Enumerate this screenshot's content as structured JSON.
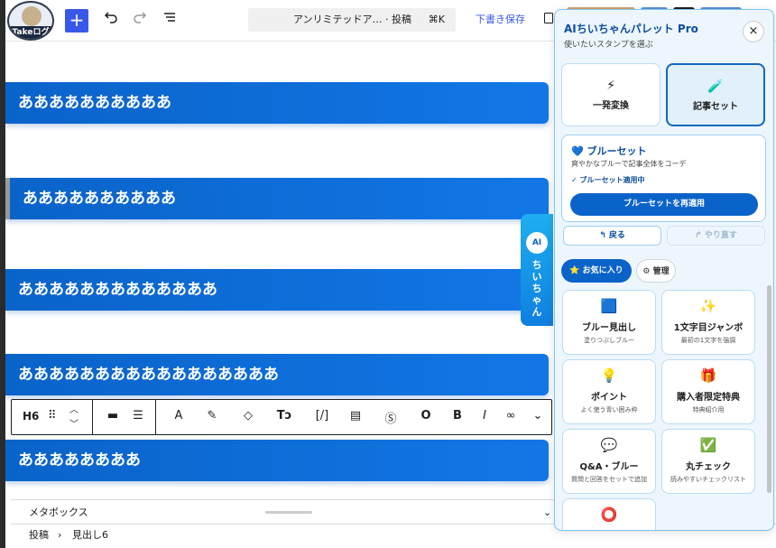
{
  "logo": {
    "text": "Takeログ"
  },
  "toolbar": {
    "add_label": "+",
    "undo_icon": "undo-icon",
    "redo_icon": "redo-icon",
    "list_icon": "list-view-icon",
    "doc_title": "アンリミテッドア… · 投稿",
    "shortcut": "⌘K",
    "save_draft": "下書き保存"
  },
  "blocks": [
    {
      "text": "ああああああああああ"
    },
    {
      "text": "ああああああああああ"
    },
    {
      "text": "あああああああああああああ"
    },
    {
      "text": "あああああああああああああああああ"
    },
    {
      "text": "ああああああああ"
    }
  ],
  "block_toolbar": {
    "heading_level": "H6",
    "items": [
      "align-icon",
      "justify-icon",
      "text-A-icon",
      "highlighter-icon",
      "tag-icon",
      "text-size-icon",
      "shortcode-icon",
      "document-icon",
      "dollar-icon",
      "circle-icon",
      "bold-icon",
      "italic-icon",
      "link-icon",
      "more-chevron-icon"
    ]
  },
  "metabox": {
    "label": "メタボックス"
  },
  "breadcrumb": {
    "root": "投稿",
    "sep": "›",
    "current": "見出し6"
  },
  "ai_tab": {
    "badge": "AI",
    "label": "ちいちゃん"
  },
  "panel": {
    "title": "AIちいちゃんパレット Pro",
    "subtitle": "使いたいスタンプを選ぶ",
    "close": "×",
    "modes": [
      {
        "label": "一発変換",
        "icon": "⚡"
      },
      {
        "label": "記事セット",
        "icon": "🧪"
      }
    ],
    "preset": {
      "heading": "💙 ブルーセット",
      "desc": "爽やかなブルーで記事全体をコーデ",
      "status": "✓ ブルーセット適用中",
      "button": "ブルーセットを再適用"
    },
    "undo": "↰ 戻る",
    "redo": "↱ やり直す",
    "tabs": [
      {
        "label": "⭐ お気に入り"
      },
      {
        "label": "⚙ 管理"
      }
    ],
    "cards": [
      {
        "icon": "🟦",
        "title": "ブルー見出し",
        "desc": "塗りつぶしブルー"
      },
      {
        "icon": "✨",
        "title": "1文字目ジャンボ",
        "desc": "最初の1文字を強調"
      },
      {
        "icon": "💡",
        "title": "ポイント",
        "desc": "よく使う青い囲み枠"
      },
      {
        "icon": "🎁",
        "title": "購入者限定特典",
        "desc": "特典紹介用"
      },
      {
        "icon": "💬",
        "title": "Q&A・ブルー",
        "desc": "質問と回答をセットで追加"
      },
      {
        "icon": "✅",
        "title": "丸チェック",
        "desc": "読みやすいチェックリスト"
      },
      {
        "icon": "⭕",
        "title": "",
        "desc": ""
      }
    ]
  },
  "colors": {
    "accent": "#3858e9",
    "heading_blue": "#0a63c9",
    "panel_border": "#7cc4f0"
  }
}
